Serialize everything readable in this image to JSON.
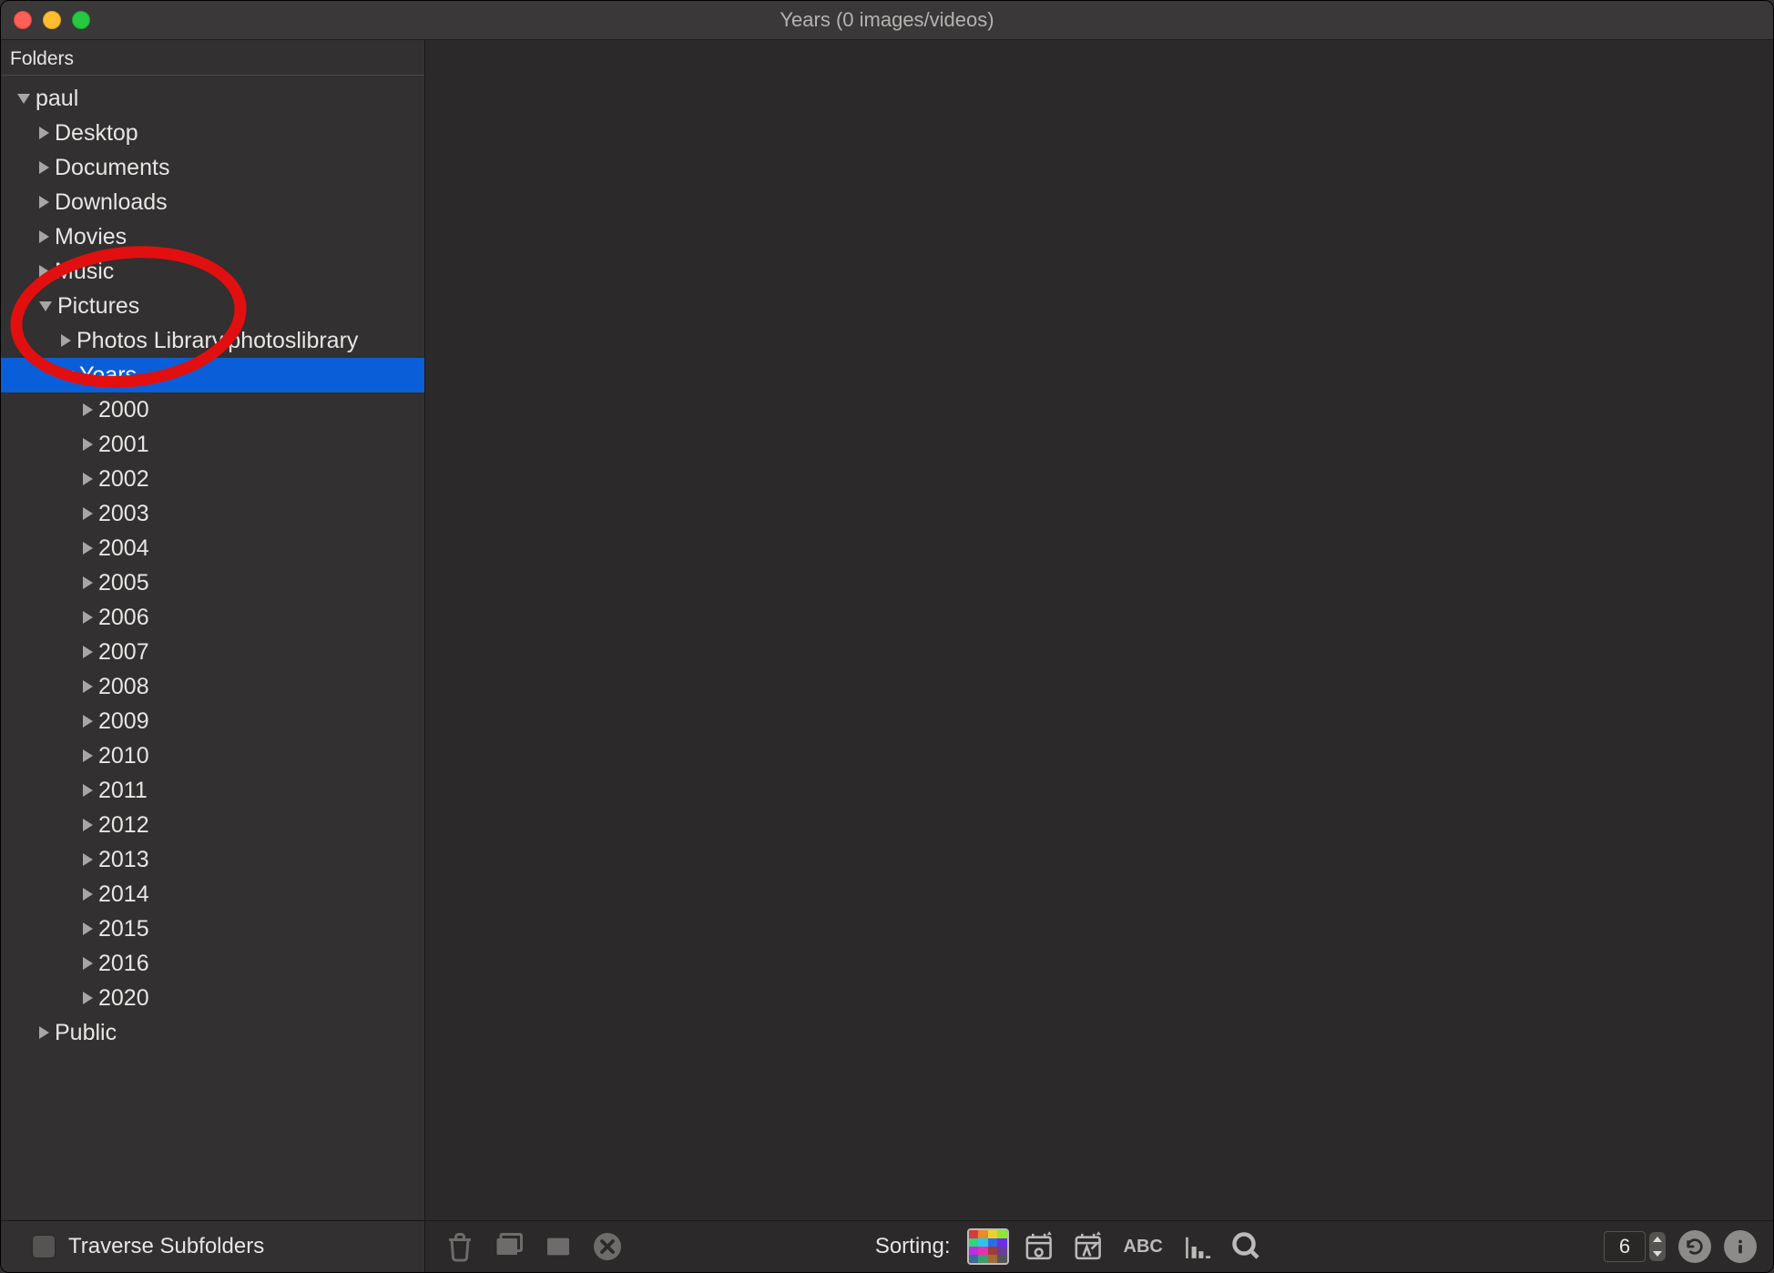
{
  "window": {
    "title": "Years (0 images/videos)"
  },
  "sidebar": {
    "header": "Folders",
    "traverse_label": "Traverse Subfolders",
    "tree": {
      "root": "paul",
      "children": [
        {
          "label": "Desktop"
        },
        {
          "label": "Documents"
        },
        {
          "label": "Downloads"
        },
        {
          "label": "Movies"
        },
        {
          "label": "Music"
        },
        {
          "label": "Pictures",
          "expanded": true,
          "children": [
            {
              "label": "Photos Library.photoslibrary"
            },
            {
              "label": "Years",
              "expanded": true,
              "selected": true,
              "children": [
                {
                  "label": "2000"
                },
                {
                  "label": "2001"
                },
                {
                  "label": "2002"
                },
                {
                  "label": "2003"
                },
                {
                  "label": "2004"
                },
                {
                  "label": "2005"
                },
                {
                  "label": "2006"
                },
                {
                  "label": "2007"
                },
                {
                  "label": "2008"
                },
                {
                  "label": "2009"
                },
                {
                  "label": "2010"
                },
                {
                  "label": "2011"
                },
                {
                  "label": "2012"
                },
                {
                  "label": "2013"
                },
                {
                  "label": "2014"
                },
                {
                  "label": "2015"
                },
                {
                  "label": "2016"
                },
                {
                  "label": "2020"
                }
              ]
            }
          ]
        },
        {
          "label": "Public"
        }
      ]
    }
  },
  "footer": {
    "sorting_label": "Sorting:",
    "thumb_columns": "6"
  },
  "color_grid_colors": [
    "#d83b3b",
    "#e88a2e",
    "#e8d22e",
    "#8ee82e",
    "#33d37d",
    "#2ec6e8",
    "#2e6be8",
    "#6a2ee8",
    "#b92ee8",
    "#e82eb2",
    "#9e3b3b",
    "#6b3b9e",
    "#3b6b9e",
    "#3b9e6b",
    "#9e6b3b",
    "#555555"
  ]
}
